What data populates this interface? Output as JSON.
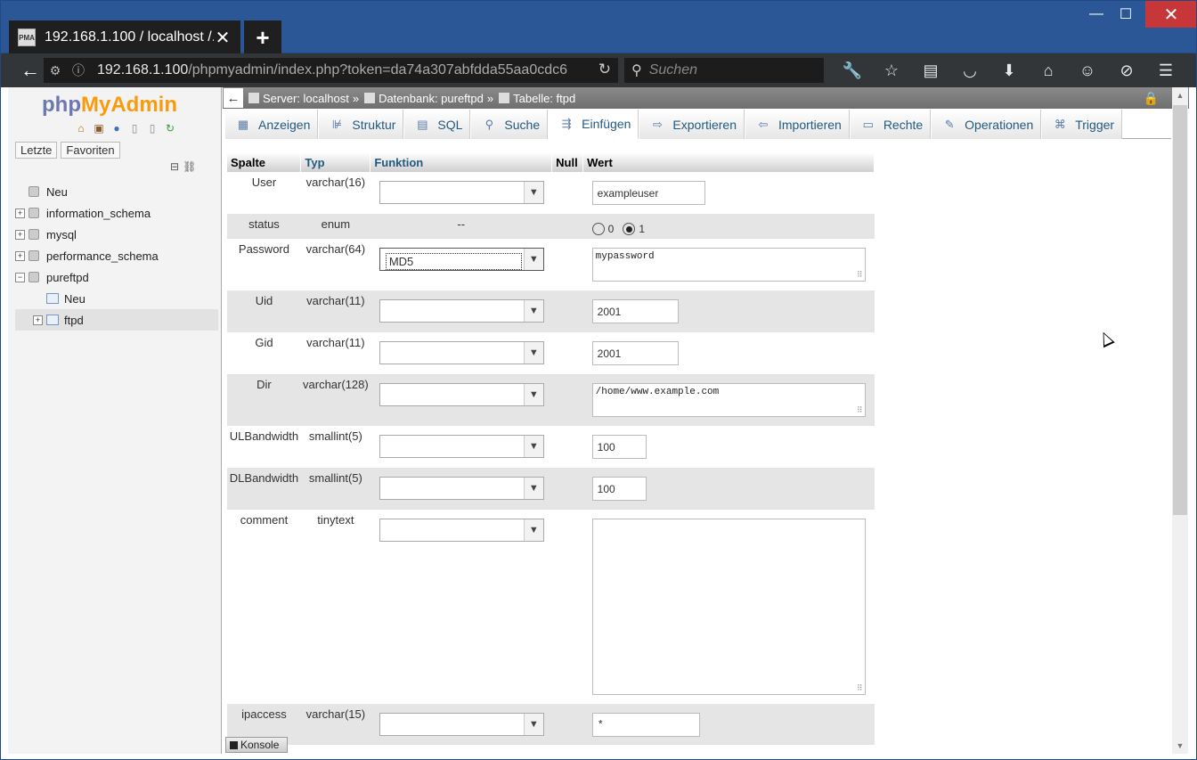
{
  "browser": {
    "tab_title": "192.168.1.100 / localhost /...",
    "tab_favicon": "PMA",
    "new_tab": "+",
    "url_host": "192.168.1.100",
    "url_path": "/phpmyadmin/index.php?token=da74a307abfdda55aa0cdc6",
    "search_placeholder": "Suchen"
  },
  "left": {
    "logo_php": "php",
    "logo_myadmin": "MyAdmin",
    "recent_label": "Letzte",
    "favorites_label": "Favoriten",
    "tree": [
      {
        "label": "Neu"
      },
      {
        "label": "information_schema"
      },
      {
        "label": "mysql"
      },
      {
        "label": "performance_schema"
      },
      {
        "label": "pureftpd"
      },
      {
        "label": "Neu"
      },
      {
        "label": "ftpd"
      }
    ]
  },
  "breadcrumb": {
    "server": "Server: localhost",
    "database": "Datenbank: pureftpd",
    "table": "Tabelle: ftpd",
    "sep": "»"
  },
  "tabs": [
    {
      "label": "Anzeigen",
      "icon": "browse-icon"
    },
    {
      "label": "Struktur",
      "icon": "structure-icon"
    },
    {
      "label": "SQL",
      "icon": "sql-icon"
    },
    {
      "label": "Suche",
      "icon": "search-icon"
    },
    {
      "label": "Einfügen",
      "icon": "insert-icon"
    },
    {
      "label": "Exportieren",
      "icon": "export-icon"
    },
    {
      "label": "Importieren",
      "icon": "import-icon"
    },
    {
      "label": "Rechte",
      "icon": "privileges-icon"
    },
    {
      "label": "Operationen",
      "icon": "wrench-icon"
    },
    {
      "label": "Trigger",
      "icon": "trigger-icon"
    }
  ],
  "table": {
    "headers": {
      "spalte": "Spalte",
      "typ": "Typ",
      "funktion": "Funktion",
      "null": "Null",
      "wert": "Wert"
    },
    "rows": [
      {
        "name": "User",
        "type": "varchar(16)",
        "function": "",
        "value": "exampleuser"
      },
      {
        "name": "status",
        "type": "enum",
        "function": "--",
        "radio0": "0",
        "radio1": "1",
        "selected": "1"
      },
      {
        "name": "Password",
        "type": "varchar(64)",
        "function": "MD5",
        "value": "mypassword"
      },
      {
        "name": "Uid",
        "type": "varchar(11)",
        "function": "",
        "value": "2001"
      },
      {
        "name": "Gid",
        "type": "varchar(11)",
        "function": "",
        "value": "2001"
      },
      {
        "name": "Dir",
        "type": "varchar(128)",
        "function": "",
        "value": "/home/www.example.com"
      },
      {
        "name": "ULBandwidth",
        "type": "smallint(5)",
        "function": "",
        "value": "100"
      },
      {
        "name": "DLBandwidth",
        "type": "smallint(5)",
        "function": "",
        "value": "100"
      },
      {
        "name": "comment",
        "type": "tinytext",
        "function": "",
        "value": ""
      },
      {
        "name": "ipaccess",
        "type": "varchar(15)",
        "function": "",
        "value": "*"
      }
    ]
  },
  "console_label": "Konsole"
}
